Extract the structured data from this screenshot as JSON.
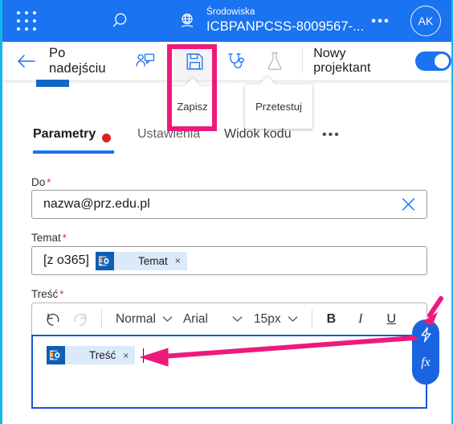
{
  "header": {
    "waffle_icon": "app-launcher-icon",
    "search_icon": "search-icon",
    "environment_icon": "environment-globe-icon",
    "environment_label": "Środowiska",
    "environment_name": "ICBPANPCSS-8009567-...",
    "more_label": "•••",
    "avatar_initials": "AK"
  },
  "commandbar": {
    "back_icon": "back-arrow-icon",
    "title": "Po nadejściu",
    "share_icon": "share-person-icon",
    "save_icon": "save-floppy-icon",
    "flowchecker_icon": "stethoscope-icon",
    "test_icon": "flask-icon",
    "toggle_label": "Nowy projektant",
    "toggle_state": "on"
  },
  "tooltips": {
    "save": "Zapisz",
    "test": "Przetestuj"
  },
  "tabs": {
    "items": [
      {
        "label": "Parametry",
        "state": "active",
        "has_dot": true
      },
      {
        "label": "Ustawienia",
        "state": "inactive",
        "has_dot": false
      },
      {
        "label": "Widok kodu",
        "state": "inactive",
        "has_dot": false
      }
    ],
    "overflow_label": "•••"
  },
  "form": {
    "to": {
      "label": "Do",
      "required_mark": "*",
      "value": "nazwa@prz.edu.pl",
      "clear_icon": "close-x-icon"
    },
    "subject": {
      "label": "Temat",
      "required_mark": "*",
      "prefix_text": "[z o365]",
      "token": {
        "icon": "outlook-icon",
        "label": "Temat",
        "remove": "×"
      }
    },
    "body": {
      "label": "Treść",
      "required_mark": "*",
      "token": {
        "icon": "outlook-icon",
        "label": "Treść",
        "remove": "×"
      }
    }
  },
  "editor_toolbar": {
    "undo_icon": "undo-icon",
    "redo_icon": "redo-icon",
    "style": {
      "value": "Normal",
      "caret": "chevron-down-icon"
    },
    "font": {
      "value": "Arial",
      "caret": "chevron-down-icon"
    },
    "size": {
      "value": "15px",
      "caret": "chevron-down-icon"
    },
    "bold": "B",
    "italic": "I",
    "underline": "U"
  },
  "fx_button": {
    "lightning_icon": "lightning-bolt-icon",
    "label": "fx"
  },
  "annotations": {
    "highlight_color": "#ed1a7b",
    "shapes": [
      "rectangle-around-save-button",
      "arrow-to-fx-button",
      "arrow-to-body-token"
    ]
  }
}
